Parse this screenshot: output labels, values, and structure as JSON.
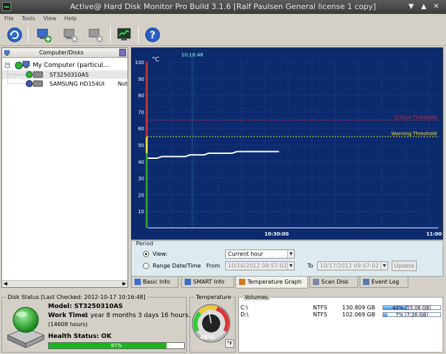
{
  "window": {
    "title": "Active@ Hard Disk Monitor Pro Build 3.1.6 [Ralf Paulsen General license 1 copy]",
    "minimize": "▼",
    "restore": "▲",
    "close": "✕"
  },
  "menu": [
    "File",
    "Tools",
    "View",
    "Help"
  ],
  "toolbar": {
    "icons": [
      "refresh-icon",
      "add-computer-icon",
      "remove-computer-icon",
      "monitor-settings-icon",
      "help-icon"
    ]
  },
  "tree": {
    "header": "Computer/Disks",
    "root_label": "My Computer (particul...",
    "disks": [
      {
        "label": "ST3250310AS",
        "extra": ""
      },
      {
        "label": "SAMSUNG HD154UI",
        "extra": "Not"
      }
    ]
  },
  "chart_data": {
    "type": "line",
    "ylabel": "°C",
    "ylim": [
      0,
      100
    ],
    "yticks": [
      10,
      20,
      30,
      40,
      50,
      60,
      70,
      80,
      90,
      100
    ],
    "xticks": [
      "10:30:00",
      "11:00:00"
    ],
    "cursor_label": "10:16:48",
    "thresholds": [
      {
        "name": "Critical Threshold",
        "value": 65,
        "color": "#d8333a"
      },
      {
        "name": "Warning Threshold",
        "value": 55,
        "color": "#f0e23c"
      }
    ],
    "zones": [
      {
        "from": 0,
        "to": 45,
        "color": "#2e9a2e"
      },
      {
        "from": 45,
        "to": 55,
        "color": "#e0d23a"
      },
      {
        "from": 55,
        "to": 100,
        "color": "#c8322f"
      }
    ],
    "series": [
      {
        "color": "#ffffff",
        "points": [
          [
            0,
            42
          ],
          [
            2,
            42
          ],
          [
            3,
            43
          ],
          [
            8,
            43
          ],
          [
            9,
            44
          ],
          [
            12,
            44
          ],
          [
            13,
            45
          ],
          [
            18,
            45
          ],
          [
            19,
            46
          ],
          [
            28,
            46
          ]
        ]
      }
    ],
    "xrange_minutes": [
      0,
      62
    ]
  },
  "period": {
    "group_label": "Period",
    "view_label": "View:",
    "view_value": "Current hour",
    "range_label": "Range Date/Time",
    "from_label": "From",
    "from_value": "10/16/2012 09:57:02",
    "to_label": "To",
    "to_value": "10/17/2012 09:57:02",
    "update_label": "Update"
  },
  "tabs": [
    {
      "label": "Basic Info",
      "active": false,
      "color": "#3a6fc8"
    },
    {
      "label": "SMART Info",
      "active": false,
      "color": "#3a6fc8"
    },
    {
      "label": "Temperature Graph",
      "active": true,
      "color": "#d07a20"
    },
    {
      "label": "Scan Disk",
      "active": false,
      "color": "#7a8aa0"
    },
    {
      "label": "Event Log",
      "active": false,
      "color": "#5a7ab0"
    }
  ],
  "disk_status": {
    "group_label": "Disk Status [Last Checked: 2012-10-17 10:16:48]",
    "model_label": "Model: ST3250310AS",
    "work_time_label": "Work Time:",
    "work_time_value": "1 year 8 months 3 days 16 hours.",
    "work_hours": "(14608 hours)",
    "health_label": "Health Status: OK",
    "health_percent": 87,
    "health_text": "87%"
  },
  "temperature": {
    "group_label": "Temperature",
    "value": 46,
    "value_text": "46°C",
    "unit_toggle": "°F"
  },
  "volumes": {
    "group_label": "Volumes",
    "rows": [
      {
        "drive": "C:\\",
        "fs": "NTFS",
        "size": "130.809 GB",
        "used_percent": 42,
        "bar_text": "42% (55.06 GB)"
      },
      {
        "drive": "D:\\",
        "fs": "NTFS",
        "size": "102.069 GB",
        "used_percent": 7,
        "bar_text": "7% (7.26 GB)"
      }
    ]
  }
}
